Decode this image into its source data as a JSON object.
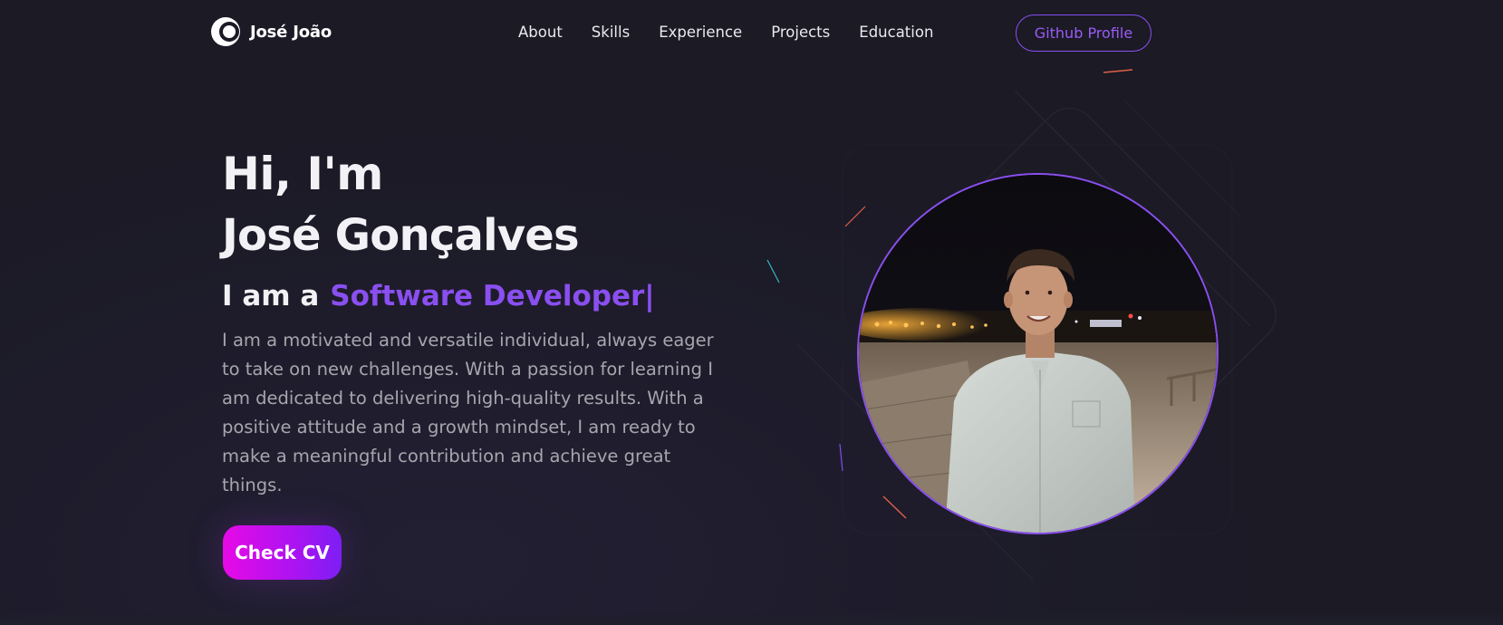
{
  "brand": {
    "name": "José João",
    "logo_icon": "crescent-circle-logo-icon"
  },
  "nav": {
    "links": [
      {
        "label": "About"
      },
      {
        "label": "Skills"
      },
      {
        "label": "Experience"
      },
      {
        "label": "Projects"
      },
      {
        "label": "Education"
      }
    ],
    "github_label": "Github Profile"
  },
  "hero": {
    "greeting": "Hi, I'm",
    "name": "José Gonçalves",
    "role_prefix": "I am a",
    "role_value": "Software Developer",
    "role_cursor": "|",
    "description": "I am a motivated and versatile individual, always eager to take on new challenges. With a passion for learning I am dedicated to delivering high-quality results. With a positive attitude and a growth mindset, I am ready to make a meaningful contribution and achieve great things.",
    "cv_button_label": "Check CV"
  },
  "colors": {
    "accent": "#8a4ff0",
    "background": "#1b1a25",
    "cv_gradient_start": "#e60ae6",
    "cv_gradient_end": "#7d1ef5"
  }
}
